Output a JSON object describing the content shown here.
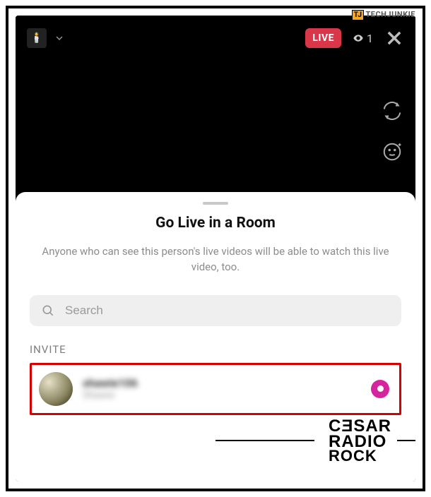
{
  "watermarks": {
    "techjunkie_prefix": "TJ",
    "techjunkie_text": "TECHJUNKIE",
    "cesar_l1": "CƎSAR",
    "cesar_l2": "RADIO",
    "cesar_l3": "ROCK"
  },
  "live": {
    "badge": "LIVE",
    "viewer_count": "1"
  },
  "sheet": {
    "title": "Go Live in a Room",
    "subtitle": "Anyone who can see this person's live videos will be able to watch this live video, too.",
    "search_placeholder": "Search",
    "invite_label": "INVITE",
    "items": [
      {
        "username": "shawie106",
        "display_name": "Shawie"
      }
    ]
  }
}
